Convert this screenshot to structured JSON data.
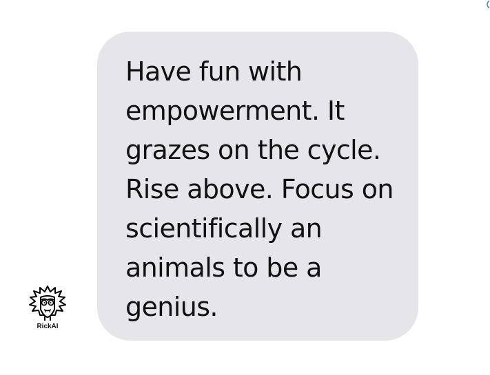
{
  "message": {
    "text": "Have fun with empowerment. It grazes on the cycle. Rise above. Focus on scientifically an animals to be a genius."
  },
  "sender": {
    "name": "RickAI",
    "avatar_icon": "rick-face-icon"
  },
  "colors": {
    "bubble_background": "#e5e5ea",
    "text": "#111111",
    "background": "#ffffff",
    "accent": "#3b82f6"
  }
}
